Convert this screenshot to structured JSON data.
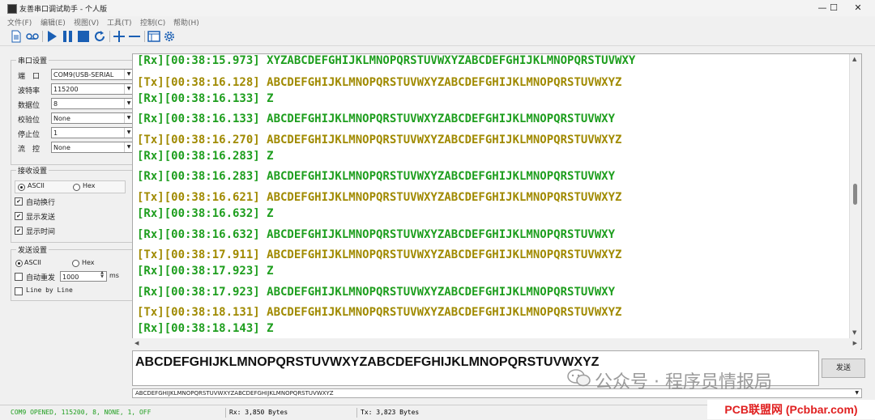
{
  "window": {
    "title": "友善串口调试助手 - 个人版",
    "controls": {
      "minimize": "—",
      "maximize": "☐",
      "close": "✕"
    }
  },
  "menu": {
    "file": "文件(F)",
    "edit": "编辑(E)",
    "view": "视图(V)",
    "tools": "工具(T)",
    "control": "控制(C)",
    "help": "帮助(H)"
  },
  "serial_settings": {
    "title": "串口设置",
    "fields": [
      {
        "label": "端　口",
        "value": "COM9(USB-SERIAL"
      },
      {
        "label": "波特率",
        "value": "115200"
      },
      {
        "label": "数据位",
        "value": "8"
      },
      {
        "label": "校验位",
        "value": "None"
      },
      {
        "label": "停止位",
        "value": "1"
      },
      {
        "label": "流　控",
        "value": "None"
      }
    ]
  },
  "receive_settings": {
    "title": "接收设置",
    "mode_ascii": "ASCII",
    "mode_hex": "Hex",
    "auto_newline": "自动换行",
    "show_send": "显示发送",
    "show_time": "显示时间"
  },
  "send_settings": {
    "title": "发送设置",
    "mode_ascii": "ASCII",
    "mode_hex": "Hex",
    "auto_resend": "自动重发",
    "interval": "1000",
    "interval_unit": "ms",
    "line_by_line": "Line by Line"
  },
  "log": [
    {
      "dir": "rx",
      "text": "[Rx][00:38:15.973] XYZABCDEFGHIJKLMNOPQRSTUVWXYZABCDEFGHIJKLMNOPQRSTUVWXY"
    },
    {
      "dir": "tx",
      "text": "[Tx][00:38:16.128] ABCDEFGHIJKLMNOPQRSTUVWXYZABCDEFGHIJKLMNOPQRSTUVWXYZ"
    },
    {
      "dir": "rx",
      "text": "[Rx][00:38:16.133] Z"
    },
    {
      "dir": "rx",
      "text": "[Rx][00:38:16.133] ABCDEFGHIJKLMNOPQRSTUVWXYZABCDEFGHIJKLMNOPQRSTUVWXY"
    },
    {
      "dir": "tx",
      "text": "[Tx][00:38:16.270] ABCDEFGHIJKLMNOPQRSTUVWXYZABCDEFGHIJKLMNOPQRSTUVWXYZ"
    },
    {
      "dir": "rx",
      "text": "[Rx][00:38:16.283] Z"
    },
    {
      "dir": "rx",
      "text": "[Rx][00:38:16.283] ABCDEFGHIJKLMNOPQRSTUVWXYZABCDEFGHIJKLMNOPQRSTUVWXY"
    },
    {
      "dir": "tx",
      "text": "[Tx][00:38:16.621] ABCDEFGHIJKLMNOPQRSTUVWXYZABCDEFGHIJKLMNOPQRSTUVWXYZ"
    },
    {
      "dir": "rx",
      "text": "[Rx][00:38:16.632] Z"
    },
    {
      "dir": "rx",
      "text": "[Rx][00:38:16.632] ABCDEFGHIJKLMNOPQRSTUVWXYZABCDEFGHIJKLMNOPQRSTUVWXY"
    },
    {
      "dir": "tx",
      "text": "[Tx][00:38:17.911] ABCDEFGHIJKLMNOPQRSTUVWXYZABCDEFGHIJKLMNOPQRSTUVWXYZ"
    },
    {
      "dir": "rx",
      "text": "[Rx][00:38:17.923] Z"
    },
    {
      "dir": "rx",
      "text": "[Rx][00:38:17.923] ABCDEFGHIJKLMNOPQRSTUVWXYZABCDEFGHIJKLMNOPQRSTUVWXY"
    },
    {
      "dir": "tx",
      "text": "[Tx][00:38:18.131] ABCDEFGHIJKLMNOPQRSTUVWXYZABCDEFGHIJKLMNOPQRSTUVWXYZ"
    },
    {
      "dir": "rx",
      "text": "[Rx][00:38:18.143] Z"
    }
  ],
  "send": {
    "input_text": "ABCDEFGHIJKLMNOPQRSTUVWXYZABCDEFGHIJKLMNOPQRSTUVWXYZ",
    "button_label": "发送",
    "history_value": "ABCDEFGHIJKLMNOPQRSTUVWXYZABCDEFGHIJKLMNOPQRSTUVWXYZ"
  },
  "status": {
    "port_state": "COM9 OPENED, 115200, 8, NONE, 1, OFF",
    "rx_count": "Rx: 3,850 Bytes",
    "tx_count": "Tx: 3,823 Bytes"
  },
  "overlay": {
    "watermark": "公众号 · 程序员情报局",
    "brand": "PCB联盟网 (Pcbbar.com)"
  },
  "colors": {
    "rx": "#1e9e1e",
    "tx": "#a08a00",
    "toolbar_icon": "#1a5fb4"
  }
}
